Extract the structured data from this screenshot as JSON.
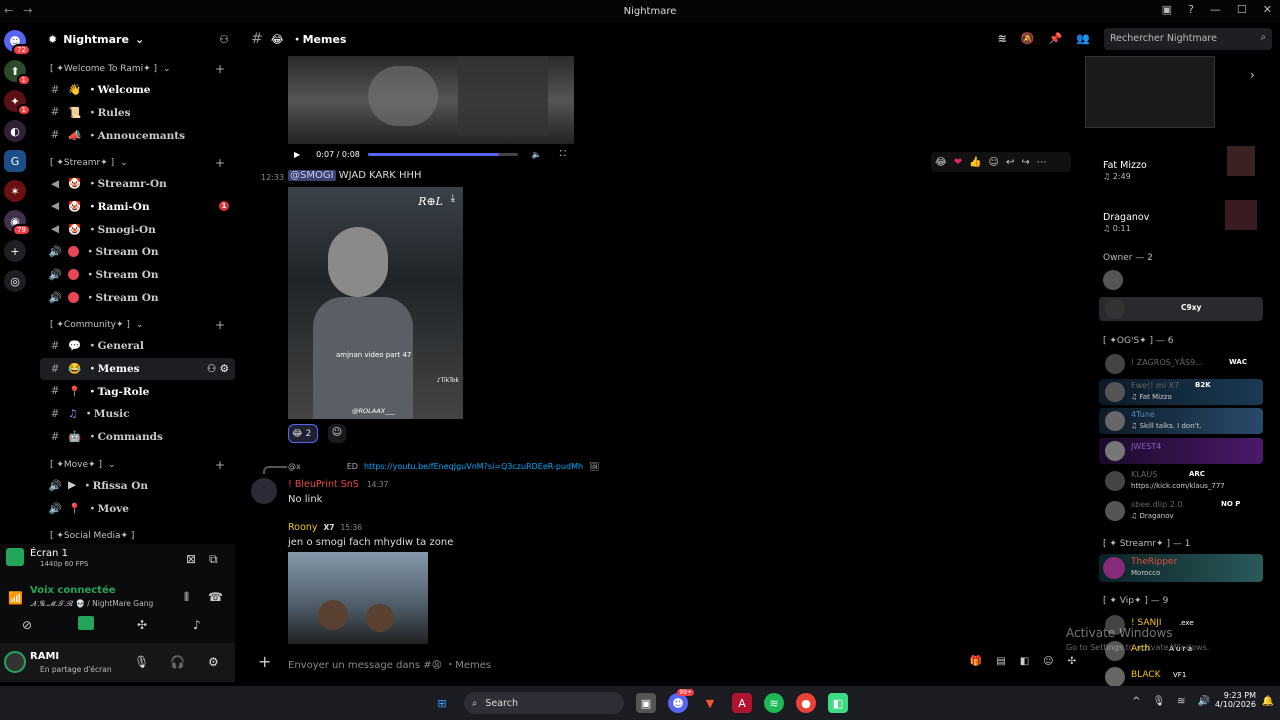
{
  "window": {
    "title": "Nightmare"
  },
  "server": {
    "name": "Nightmare"
  },
  "guild_badges": [
    "72",
    "1",
    "1",
    "79"
  ],
  "categories": {
    "welcome": "[ ✦Welcome To Rami✦ ]",
    "streamr": "[ ✦Streamr✦ ]",
    "community": "[ ✦Community✦ ]",
    "move": "[ ✦Move✦ ]",
    "social": "[ ✦Social Media✦ ]"
  },
  "channels": {
    "welcome": "・Welcome",
    "rules": "・Rules",
    "annonces": "・Annoucemants",
    "streamr_on": "・Streamr-On",
    "rami_on": "・Rami-On",
    "rami_badge": "1",
    "smogi_on": "・Smogi-On",
    "stream1": "・Stream On",
    "stream2": "・Stream On",
    "stream3": "・Stream On",
    "general": "・General",
    "memes": "・Memes",
    "tagrole": "・Tag-Role",
    "music": "・Music",
    "commands": "・Commands",
    "rfissa": "・Rfissa On",
    "move": "・Move"
  },
  "voice": {
    "screen_title": "Écran 1",
    "screen_sub": "1440p 60 FPS",
    "status": "Voix connectée",
    "location": "𝓝.𝓖.𝓜.𝓣.𝓡 💀 / NightMare Gang"
  },
  "user": {
    "name": "RAMI",
    "status": "En partage d'écran"
  },
  "header": {
    "channel": "・Memes",
    "search_placeholder": "Rechercher Nightmare"
  },
  "video": {
    "time": "0:07 / 0:08",
    "progress": 0.875
  },
  "messages": {
    "time1": "12:33",
    "mention": "@SMOGI",
    "text1": "WJAD KARK HHH",
    "overlay_caption": "amjnan video part 47",
    "overlay_handle": "@ROLAAX___",
    "reaction_count": "2",
    "reply_user": "@x",
    "reply_tag": "ED",
    "reply_link": "https://youtu.be/fEneqJguVnM?si=Q3czuRDEeR-pudMh",
    "author2": "! BleuPrint SnS",
    "time2": "14:37",
    "text2": "No link",
    "author3": "Roony",
    "tag3": "X7",
    "time3": "15:36",
    "text3": "jen o smogi fach mhydiw ta zone"
  },
  "composer": {
    "placeholder": "Envoyer un message dans #😩 ・Memes"
  },
  "members": {
    "now_playing": [
      {
        "name": "Fat Mizzo",
        "sub": "♫ 2:49"
      },
      {
        "name": "Draganov",
        "sub": "♫ 0:11"
      }
    ],
    "owner_header": "Owner — 2",
    "og_header": "[ ✦OG'S✦ ] — 6",
    "og": [
      {
        "name": "! ZAGROS_YÅS9...",
        "tag": "WAC",
        "sub": ""
      },
      {
        "name": "Fwe!! mi X7",
        "tag": "B2K",
        "sub": "♫ Fat Mizzo"
      },
      {
        "name": "4Tune",
        "tag": "",
        "sub": "♫ Skill talks. I don't."
      },
      {
        "name": "JWEST4",
        "tag": "",
        "sub": ""
      },
      {
        "name": "KLAUS",
        "tag": "ARC",
        "sub": "https://kick.com/klaus_777"
      },
      {
        "name": "sbee.dlip 2.0",
        "tag": "NO P",
        "sub": "♫ Draganov"
      }
    ],
    "owner_tag": "C9xy",
    "streamr_header": "[ ✦ Streamr✦ ] — 1",
    "streamr": {
      "name": "TheRipper",
      "sub": "Morocco"
    },
    "vip_header": "[ ✦ Vip✦ ] — 9",
    "vip": [
      {
        "name": "! SANJI",
        "tag": ".exe"
      },
      {
        "name": "Arth",
        "tag": "A u r a"
      },
      {
        "name": "BLACK",
        "tag": "VF1"
      }
    ]
  },
  "watermark": {
    "line1": "Activate Windows",
    "line2": "Go to Settings to activate Windows."
  },
  "taskbar": {
    "search": "Search",
    "time": "9:23 PM",
    "date": "4/10/2026",
    "badge": "99+"
  }
}
